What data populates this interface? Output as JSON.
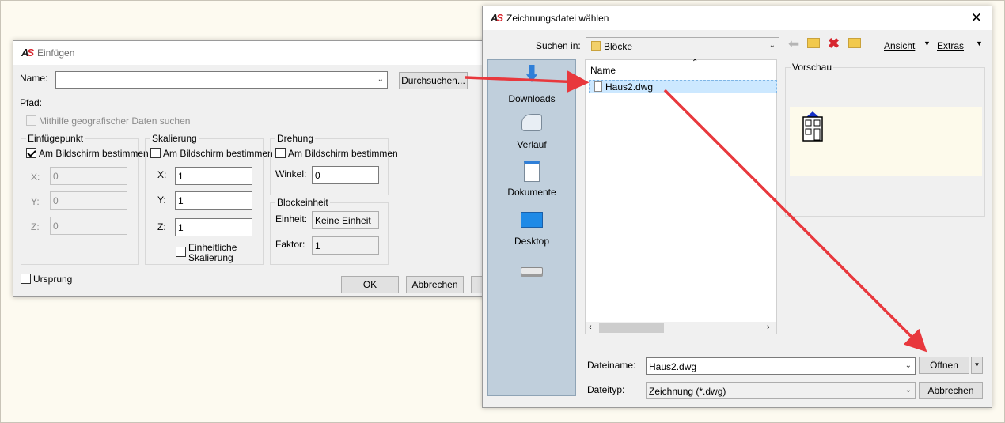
{
  "insert_dialog": {
    "title": "Einfügen",
    "name_label": "Name:",
    "name_value": "",
    "browse_button": "Durchsuchen...",
    "path_label": "Pfad:",
    "geo_checkbox": "Mithilfe geografischer Daten suchen",
    "insertion_point": {
      "legend": "Einfügepunkt",
      "on_screen": "Am Bildschirm bestimmen",
      "x_label": "X:",
      "x_value": "0",
      "y_label": "Y:",
      "y_value": "0",
      "z_label": "Z:",
      "z_value": "0"
    },
    "scale": {
      "legend": "Skalierung",
      "on_screen": "Am Bildschirm bestimmen",
      "x_label": "X:",
      "x_value": "1",
      "y_label": "Y:",
      "y_value": "1",
      "z_label": "Z:",
      "z_value": "1",
      "uniform_line1": "Einheitliche",
      "uniform_line2": "Skalierung"
    },
    "rotation": {
      "legend": "Drehung",
      "on_screen": "Am Bildschirm bestimmen",
      "angle_label": "Winkel:",
      "angle_value": "0"
    },
    "block_unit": {
      "legend": "Blockeinheit",
      "unit_label": "Einheit:",
      "unit_value": "Keine Einheit",
      "factor_label": "Faktor:",
      "factor_value": "1"
    },
    "explode_checkbox": "Ursprung",
    "ok_button": "OK",
    "cancel_button": "Abbrechen"
  },
  "file_dialog": {
    "title": "Zeichnungsdatei wählen",
    "look_in_label": "Suchen in:",
    "look_in_value": "Blöcke",
    "views_label": "Ansicht",
    "tools_label": "Extras",
    "places": [
      {
        "label": "Downloads"
      },
      {
        "label": "Verlauf"
      },
      {
        "label": "Dokumente"
      },
      {
        "label": "Desktop"
      }
    ],
    "list_header": "Name",
    "files": [
      {
        "name": "Haus2.dwg"
      }
    ],
    "preview_label": "Vorschau",
    "filename_label": "Dateiname:",
    "filename_value": "Haus2.dwg",
    "filetype_label": "Dateityp:",
    "filetype_value": "Zeichnung (*.dwg)",
    "open_button": "Öffnen",
    "cancel_button": "Abbrechen"
  },
  "colors": {
    "annotation_arrow": "#e8383d",
    "selection": "#cce8ff",
    "places_bg": "#c0cfdc",
    "preview_bg": "#fdfaeb"
  }
}
